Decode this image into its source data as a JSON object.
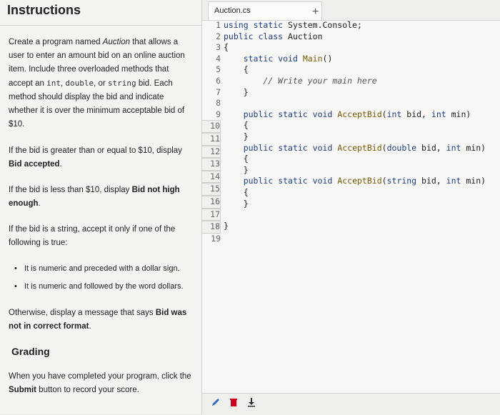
{
  "instructions": {
    "title": "Instructions",
    "p1_a": "Create a program named ",
    "p1_b": "Auction",
    "p1_c": " that allows a user to enter an amount bid on an online auction item. Include three overloaded methods that accept an ",
    "p1_int": "int",
    "p1_sep1": ", ",
    "p1_double": "double",
    "p1_sep2": ", or ",
    "p1_string": "string",
    "p1_d": " bid. Each method should display the bid and indicate whether it is over the minimum acceptable bid of $10.",
    "p2_a": "If the bid is greater than or equal to $10, display ",
    "p2_b": "Bid accepted",
    "p2_c": ".",
    "p3_a": "If the bid is less than $10, display ",
    "p3_b": "Bid not high enough",
    "p3_c": ".",
    "p4": "If the bid is a string, accept it only if one of the following is true:",
    "bullets": [
      "It is numeric and preceded with a dollar sign.",
      "It is numeric and followed by the word dollars."
    ],
    "p5_a": "Otherwise, display a message that says ",
    "p5_b": "Bid was not in correct format",
    "p5_c": ".",
    "grading_title": "Grading",
    "p6_a": "When you have completed your program, click the ",
    "p6_b": "Submit",
    "p6_c": " button to record your score."
  },
  "editor": {
    "tab_name": "Auction.cs",
    "add_tab": "+",
    "line_numbers": [
      "1",
      "2",
      "3",
      "4",
      "5",
      "6",
      "7",
      "8",
      "9",
      "10",
      "11",
      "12",
      "13",
      "14",
      "15",
      "16",
      "17",
      "18",
      "19"
    ],
    "lines": [
      "using static System.Console;",
      "public class Auction",
      "{",
      "    static void Main()",
      "    {",
      "        // Write your main here",
      "    }",
      "",
      "    public static void AcceptBid(int bid, int min)",
      "    {",
      "    }",
      "    public static void AcceptBid(double bid, int min)",
      "    {",
      "    }",
      "    public static void AcceptBid(string bid, int min)",
      "    {",
      "    }",
      "",
      "}"
    ]
  },
  "toolbar": {
    "pencil_icon": "pencil-icon",
    "trash_icon": "trash-icon",
    "download_icon": "download-icon"
  },
  "colors": {
    "keyword": "#1f3d8a",
    "method": "#7a5a00",
    "delete": "#d0021b",
    "edit": "#2b6cd4"
  }
}
